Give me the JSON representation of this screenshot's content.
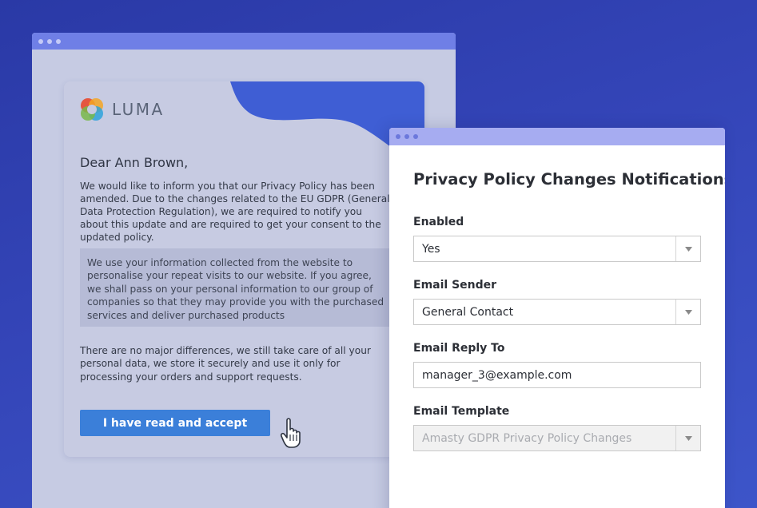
{
  "colors": {
    "background": "#3040b0",
    "accent_button": "#3b7fd9",
    "titlebar_back": "#6f7fe6",
    "titlebar_front": "#a6acf1"
  },
  "email": {
    "logo_text": "LUMA",
    "greeting": "Dear Ann Brown,",
    "paragraph1": "We would like to inform you that our Privacy Policy has been amended. Due to the changes related to the EU GDPR (General Data Protection Regulation), we are required to notify you about this update and are required to get your consent to the updated policy.",
    "quote": "We use your information collected from the website to personalise your repeat visits to our website. If you agree, we shall pass on your personal information to our group of companies so that they may provide you with the purchased services and deliver purchased products",
    "paragraph2": "There are no major differences, we still take care of all your personal data, we store it securely and use it only for processing your orders and support requests.",
    "accept_button": "I have read and accept",
    "cursor_icon": "hand-pointer-icon"
  },
  "settings": {
    "title": "Privacy Policy Changes Notifications",
    "enabled": {
      "label": "Enabled",
      "value": "Yes"
    },
    "sender": {
      "label": "Email Sender",
      "value": "General Contact"
    },
    "reply_to": {
      "label": "Email Reply To",
      "value": "manager_3@example.com"
    },
    "template": {
      "label": "Email Template",
      "value": "Amasty GDPR Privacy Policy Changes",
      "disabled": true
    }
  }
}
